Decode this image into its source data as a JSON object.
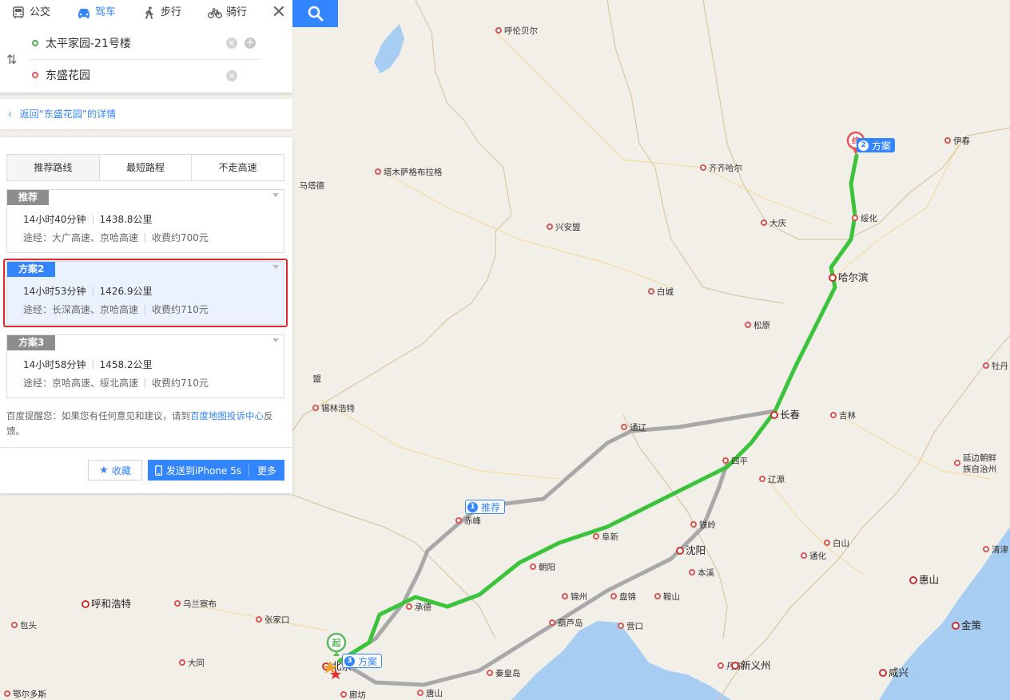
{
  "modes": [
    {
      "label": "公交",
      "icon": "bus-icon",
      "active": false
    },
    {
      "label": "驾车",
      "icon": "car-icon",
      "active": true
    },
    {
      "label": "步行",
      "icon": "walk-icon",
      "active": false
    },
    {
      "label": "骑行",
      "icon": "bike-icon",
      "active": false
    }
  ],
  "route": {
    "start": "太平家园-21号楼",
    "end": "东盛花园"
  },
  "back_link": "返回“东盛花园”的详情",
  "tabs": [
    "推荐路线",
    "最短路程",
    "不走高速"
  ],
  "plans": [
    {
      "tag": "推荐",
      "time": "14小时40分钟",
      "distance": "1438.8公里",
      "via": "途经：大广高速、京哈高速",
      "toll": "收费约700元",
      "selected": false
    },
    {
      "tag": "方案2",
      "time": "14小时53分钟",
      "distance": "1426.9公里",
      "via": "途经：长深高速、京哈高速",
      "toll": "收费约710元",
      "selected": true
    },
    {
      "tag": "方案3",
      "time": "14小时58分钟",
      "distance": "1458.2公里",
      "via": "途经：京哈高速、绥北高速",
      "toll": "收费约710元",
      "selected": false
    }
  ],
  "tip": {
    "prefix": "百度提醒您：如果您有任何意见和建议，请到",
    "link": "百度地图投诉中心",
    "suffix": "反馈。"
  },
  "actions": {
    "favorite": "收藏",
    "send": "发送到iPhone 5s",
    "more": "更多"
  },
  "map": {
    "bubbles": [
      {
        "num": "2",
        "label": "方案",
        "style": "blue"
      },
      {
        "num": "1",
        "label": "推荐",
        "style": "white"
      },
      {
        "num": "3",
        "label": "方案",
        "style": "white"
      }
    ],
    "start_marker": "起",
    "end_marker": "终",
    "cities": [
      {
        "name": "呼伦贝尔"
      },
      {
        "name": "伊春"
      },
      {
        "name": "齐齐哈尔"
      },
      {
        "name": "塔木萨格布拉格"
      },
      {
        "name": "马塔德"
      },
      {
        "name": "大庆"
      },
      {
        "name": "绥化"
      },
      {
        "name": "兴安盟"
      },
      {
        "name": "哈尔滨"
      },
      {
        "name": "白城"
      },
      {
        "name": "松原"
      },
      {
        "name": "牡丹"
      },
      {
        "name": "锡林浩特"
      },
      {
        "name": "长春"
      },
      {
        "name": "吉林"
      },
      {
        "name": "通辽"
      },
      {
        "name": "四平"
      },
      {
        "name": "辽源"
      },
      {
        "name": "延边朝鲜族自治州"
      },
      {
        "name": "赤峰"
      },
      {
        "name": "阜新"
      },
      {
        "name": "铁岭"
      },
      {
        "name": "白山"
      },
      {
        "name": "沈阳"
      },
      {
        "name": "通化"
      },
      {
        "name": "清津"
      },
      {
        "name": "朝阳"
      },
      {
        "name": "本溪"
      },
      {
        "name": "惠山"
      },
      {
        "name": "呼和浩特"
      },
      {
        "name": "乌兰察布"
      },
      {
        "name": "承德"
      },
      {
        "name": "锦州"
      },
      {
        "name": "盘锦"
      },
      {
        "name": "鞍山"
      },
      {
        "name": "包头"
      },
      {
        "name": "张家口"
      },
      {
        "name": "葫芦岛"
      },
      {
        "name": "营口"
      },
      {
        "name": "金策"
      },
      {
        "name": "大同"
      },
      {
        "name": "丹东"
      },
      {
        "name": "新义州"
      },
      {
        "name": "秦皇岛"
      },
      {
        "name": "咸兴"
      },
      {
        "name": "鄂尔多斯"
      },
      {
        "name": "唐山"
      },
      {
        "name": "廊坊"
      },
      {
        "name": "盟"
      },
      {
        "name": "北京"
      }
    ]
  }
}
